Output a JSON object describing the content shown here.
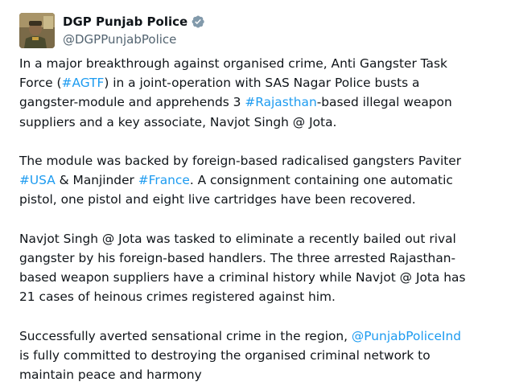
{
  "account": {
    "display_name": "DGP Punjab Police",
    "handle": "@DGPPunjabPolice",
    "verified_icon": "verified-badge-icon",
    "avatar_icon": "profile-avatar"
  },
  "colors": {
    "link": "#1d9bf0",
    "text": "#0f1419",
    "secondary_text": "#536471",
    "verified_badge": "#829aab"
  },
  "tweet": {
    "p1": {
      "l1": "In a major breakthrough against organised crime, Anti Gangster Task",
      "l2a": "Force (",
      "l2_link": "#AGTF",
      "l2b": ") in a joint-operation with SAS Nagar Police busts a",
      "l3a": "gangster-module and apprehends 3 ",
      "l3_link": "#Rajasthan",
      "l3b": "-based illegal weapon",
      "l4": "suppliers and a key associate, Navjot Singh @ Jota."
    },
    "p2": {
      "l1": "The module was backed by foreign-based radicalised gangsters Paviter",
      "l2_link1": "#USA",
      "l2a": " & Manjinder ",
      "l2_link2": "#France",
      "l2b": ". A consignment containing one automatic",
      "l3": "pistol, one pistol and eight live cartridges have been recovered."
    },
    "p3": {
      "l1": "Navjot Singh @ Jota was tasked to eliminate a recently bailed out rival",
      "l2": "gangster by his foreign-based handlers. The three arrested Rajasthan-",
      "l3": "based weapon suppliers have a criminal history while Navjot @ Jota has",
      "l4": "21 cases of heinous crimes registered against him."
    },
    "p4": {
      "l1a": "Successfully averted sensational crime in the region, ",
      "l1_link": "@PunjabPoliceInd",
      "l2": "is fully committed to destroying the organised criminal network to",
      "l3": "maintain peace and harmony"
    }
  }
}
